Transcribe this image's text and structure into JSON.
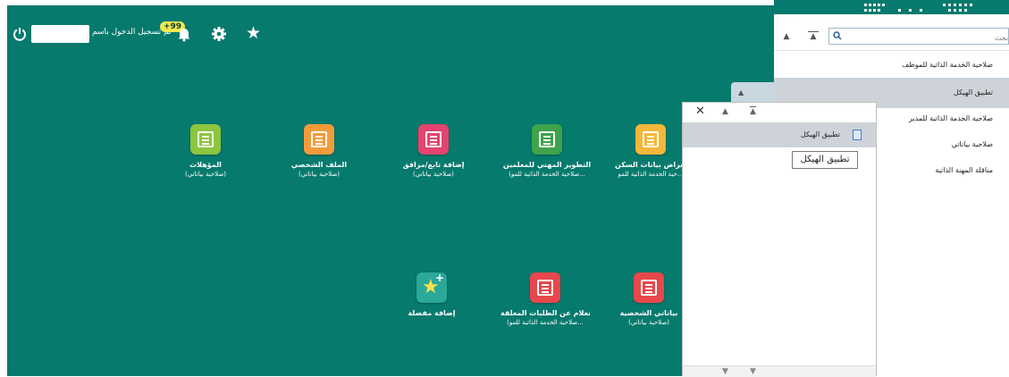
{
  "header": {
    "logged_in_label": "تم تسجيل الدخول باسم",
    "user_name": "",
    "notification_count": "+99",
    "icons": [
      "power-icon",
      "bell-icon",
      "gear-icon",
      "star-icon"
    ]
  },
  "tiles": [
    {
      "name": "المؤهلات",
      "sub": "(صلاحية بياناتي)",
      "color": "#8cc63f"
    },
    {
      "name": "الملف الشخصي",
      "sub": "(صلاحية بياناتي)",
      "color": "#f39b3b"
    },
    {
      "name": "إضافة تابع/مرافق",
      "sub": "(صلاحية بياناتي)",
      "color": "#e4436f"
    },
    {
      "name": "التطوير المهني للمعلمين",
      "sub": "(صلاحية الخدمة الذاتية للمو...",
      "color": "#3fa34d"
    },
    {
      "name": "تعراض بيانات السكن",
      "sub": "حية الخدمة الذاتية للمو...",
      "color": "#f4b73a"
    },
    {
      "name": "إضافة مفضلة",
      "sub": "",
      "color": "#2aa89a"
    },
    {
      "name": "الاستعلام عن الطلبات المعلقة",
      "sub": "(صلاحية الخدمة الذاتية للمو...",
      "color": "#e8474b"
    },
    {
      "name": "بياناتي الشخصية",
      "sub": "(صلاحية بياناتي)",
      "color": "#e8474b"
    }
  ],
  "right_panel": {
    "search_placeholder": "بحث",
    "items": [
      "صلاحية الخدمة الذاتية للموظف",
      "تطبيق الهيكل",
      "صلاحية الخدمة الذاتية للمدير",
      "صلاحية بياناتي",
      "مناقلة المهنة الذاتية"
    ],
    "selected_index": 1
  },
  "mid_panel": {
    "item_label": "تطبيق الهيكل",
    "tooltip": "تطبيق الهيكل"
  }
}
